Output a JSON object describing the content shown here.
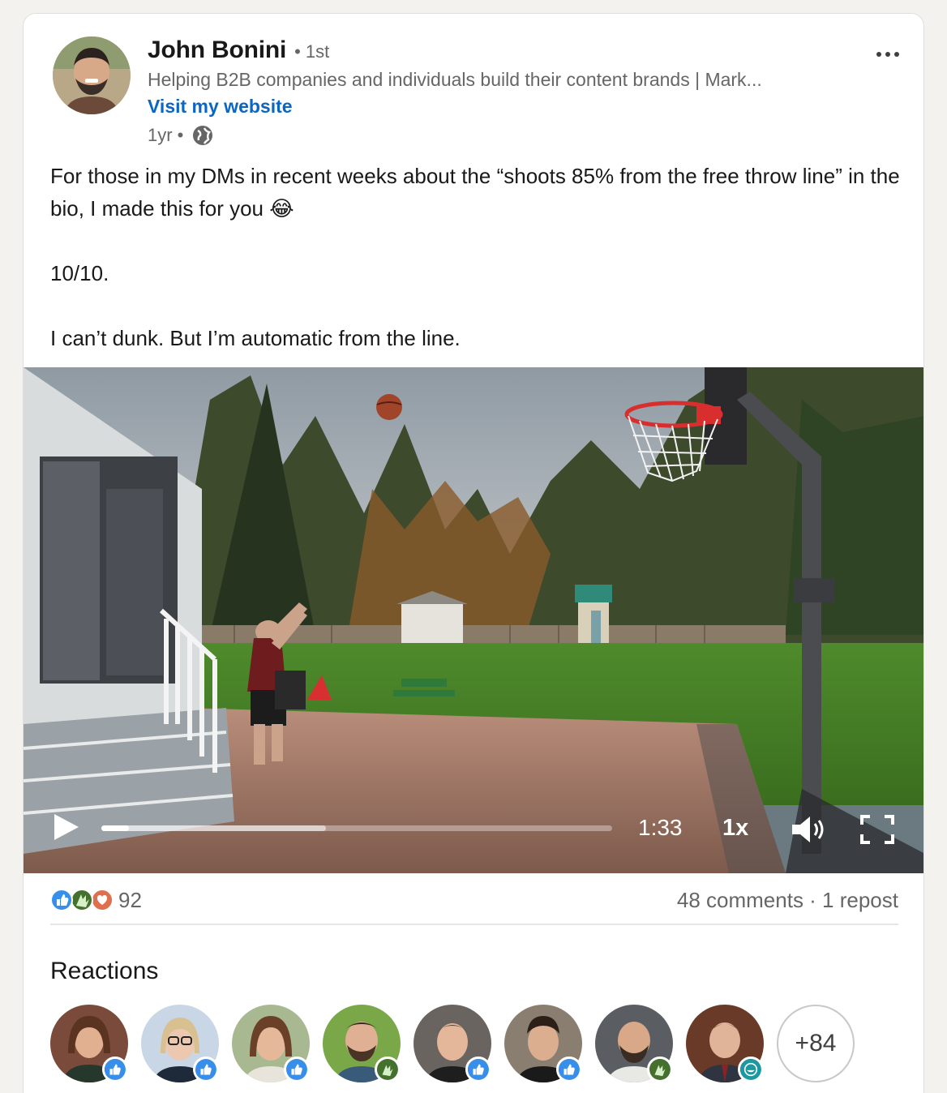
{
  "author": {
    "name": "John Bonini",
    "degree": "• 1st",
    "headline": "Helping B2B companies and individuals build their content brands | Mark...",
    "website_label": "Visit my website",
    "time": "1yr •",
    "visibility_icon": "globe-icon"
  },
  "post": {
    "line1": "For those in my DMs in recent weeks about the “shoots 85% from the free throw line” in the bio, I made this for you 😂",
    "line2": "10/10.",
    "line3": "I can’t dunk. But I’m automatic from the line."
  },
  "video": {
    "time": "1:33",
    "speed": "1x",
    "played_fraction": 0.054,
    "buffered_fraction": 0.44,
    "icons": [
      "play-icon",
      "volume-icon",
      "fullscreen-icon"
    ]
  },
  "social": {
    "reaction_count": "92",
    "stats": "48 comments · 1 repost",
    "reaction_types": [
      "like",
      "celebrate",
      "love"
    ]
  },
  "reactions": {
    "title": "Reactions",
    "more": "+84",
    "people": [
      {
        "reaction": "like"
      },
      {
        "reaction": "like"
      },
      {
        "reaction": "like"
      },
      {
        "reaction": "celebrate"
      },
      {
        "reaction": "like"
      },
      {
        "reaction": "like"
      },
      {
        "reaction": "celebrate"
      },
      {
        "reaction": "funny"
      }
    ]
  },
  "colors": {
    "link": "#0a66c2",
    "like": "#378fe9",
    "celebrate": "#44712e",
    "love": "#df704d",
    "funny": "#1a9aa0"
  }
}
